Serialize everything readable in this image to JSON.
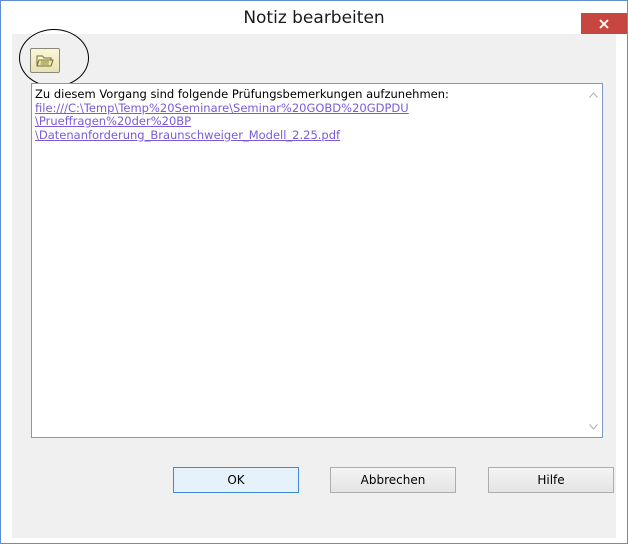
{
  "window": {
    "title": "Notiz bearbeiten",
    "close_icon": "close-icon"
  },
  "toolbar": {
    "open_file_icon": "open-folder-icon"
  },
  "note": {
    "intro": "Zu diesem Vorgang sind folgende Prüfungsbemerkungen aufzunehmen:",
    "link_lines": [
      "file:///C:\\Temp\\Temp%20Seminare\\Seminar%20GOBD%20GDPDU",
      "\\Prueffragen%20der%20BP",
      "\\Datenanforderung_Braunschweiger_Modell_2.25.pdf"
    ]
  },
  "buttons": {
    "ok": "OK",
    "cancel": "Abbrechen",
    "help": "Hilfe"
  },
  "colors": {
    "close_button": "#c7463f",
    "link": "#7b5bd6",
    "border_accent": "#5f8fcf"
  }
}
